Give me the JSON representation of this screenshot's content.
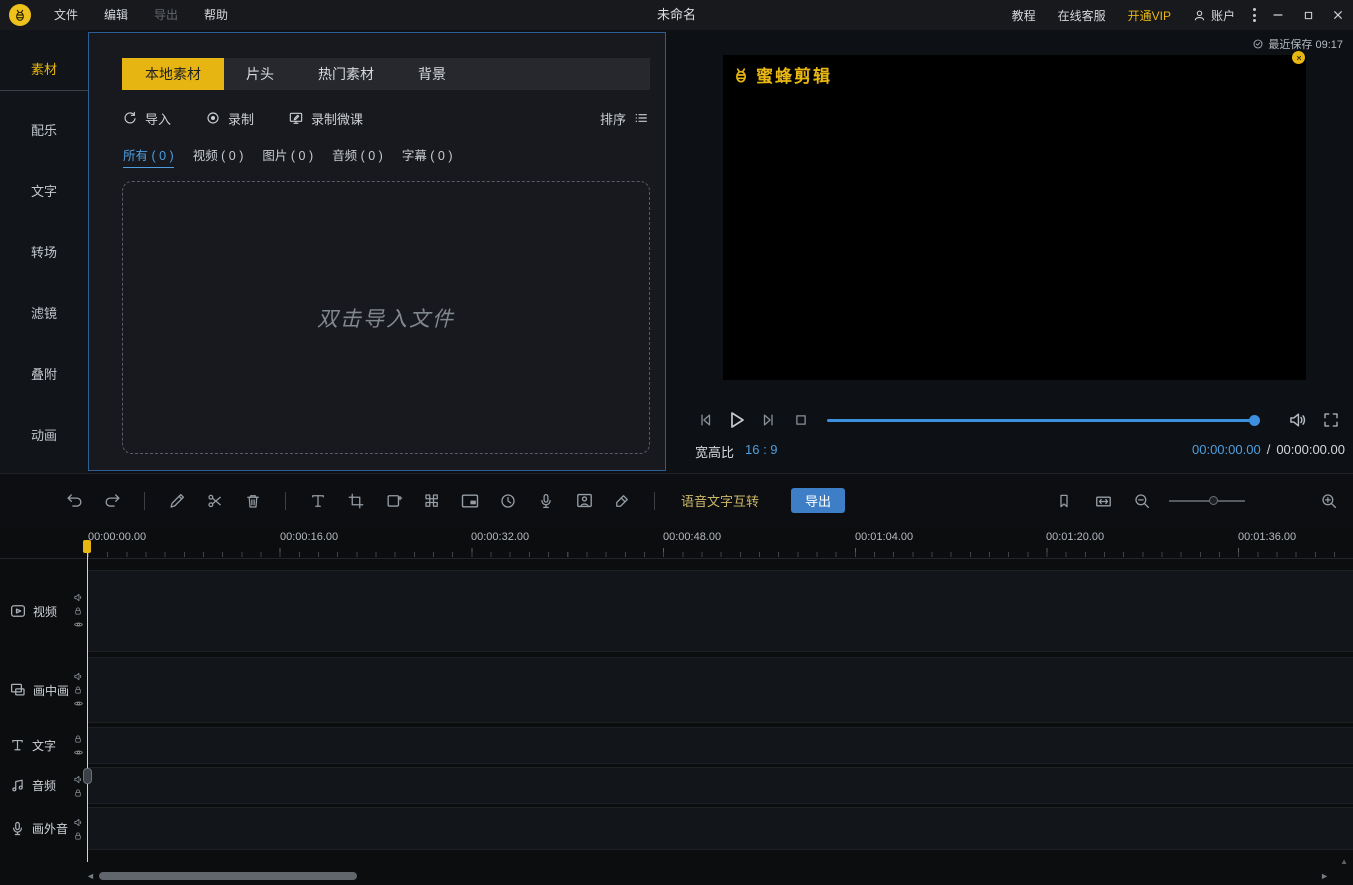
{
  "colors": {
    "accent_yellow": "#e9b712",
    "accent_blue": "#4e9fe0",
    "export_button_blue": "#3e7ec6",
    "active_tab_yellow": "#e7b512"
  },
  "titlebar": {
    "app_title": "未命名",
    "menu_file": "文件",
    "menu_edit": "编辑",
    "menu_export": "导出",
    "menu_help": "帮助",
    "tutorial": "教程",
    "online_support": "在线客服",
    "vip": "开通VIP",
    "account": "账户"
  },
  "sidebar": {
    "items": [
      {
        "label": "素材"
      },
      {
        "label": "配乐"
      },
      {
        "label": "文字"
      },
      {
        "label": "转场"
      },
      {
        "label": "滤镜"
      },
      {
        "label": "叠附"
      },
      {
        "label": "动画"
      }
    ]
  },
  "material_panel": {
    "tabs": [
      {
        "label": "本地素材"
      },
      {
        "label": "片头"
      },
      {
        "label": "热门素材"
      },
      {
        "label": "背景"
      }
    ],
    "import_label": "导入",
    "record_label": "录制",
    "record_lesson_label": "录制微课",
    "sort_label": "排序",
    "filters": [
      {
        "label": "所有 ( 0 )"
      },
      {
        "label": "视频 ( 0 )"
      },
      {
        "label": "图片 ( 0 )"
      },
      {
        "label": "音频 ( 0 )"
      },
      {
        "label": "字幕 ( 0 )"
      }
    ],
    "dropzone_text": "双击导入文件"
  },
  "preview": {
    "saved_notice": "最近保存 09:17",
    "watermark_text": "蜜蜂剪辑",
    "aspect_label": "宽高比",
    "aspect_value": "16 : 9",
    "current_time": "00:00:00.00",
    "time_separator": "/",
    "total_time": "00:00:00.00"
  },
  "toolbar": {
    "voice_text_label": "语音文字互转",
    "export_label": "导出"
  },
  "timeline": {
    "ruler_labels": [
      "00:00:00.00",
      "00:00:16.00",
      "00:00:32.00",
      "00:00:48.00",
      "00:01:04.00",
      "00:01:20.00",
      "00:01:36.00"
    ],
    "tracks": [
      {
        "label": "视频"
      },
      {
        "label": "画中画"
      },
      {
        "label": "文字"
      },
      {
        "label": "音频"
      },
      {
        "label": "画外音"
      }
    ]
  }
}
